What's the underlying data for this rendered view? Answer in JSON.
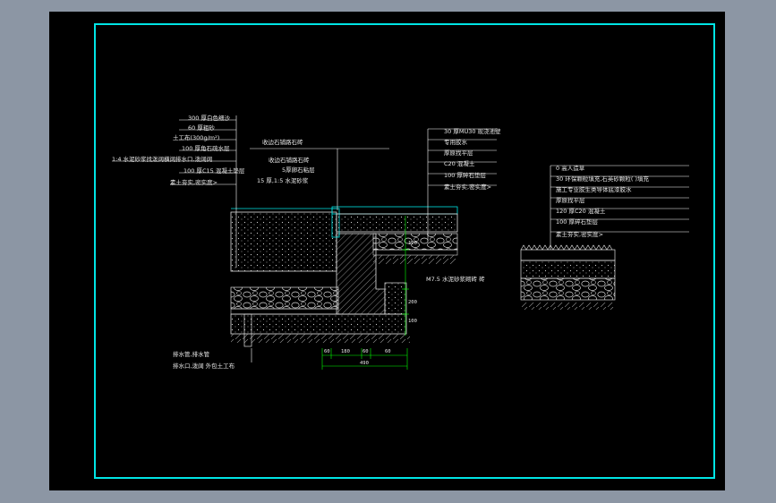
{
  "colors": {
    "background": "#8c96a4",
    "paper": "#000000",
    "border": "#00e5e5",
    "leader": "#ffffff",
    "dimension": "#00ff00",
    "water": "#00e5e5",
    "stone": "#e0e0e0",
    "hatch": "#b0b0b0"
  },
  "left_labels": [
    "300 厚白色细沙",
    "60 厚粗砂",
    "土工布(300g/m²)",
    "100 厚角石疏水层",
    "1:4 水泥砂浆找泼阔横阔排水口,泼阔阔",
    "100 厚C15 混凝土垫层",
    "素土夯实,密实度>"
  ],
  "middle_labels": [
    "收边石铺路石砖",
    "收边石铺路石砖",
    "5厚卵石粘层",
    "15 厚,1:5 水泥砂浆"
  ],
  "right_labels": [
    "30 厚MU30 现浇池壁",
    "专用胶水",
    "厚原找平层",
    "C20 混凝土",
    "100 厚碎石垫层",
    "素土夯实,密实度>"
  ],
  "far_right_labels": [
    "0 高人造草",
    "30 环保颗粒填充,石英砂颗粒( )填充",
    "施工专业胶生类导体底漆胶水",
    "厚原找平层",
    "120 厚C20 混凝土",
    "100 厚碎石垫层",
    "素土夯实,密实度>"
  ],
  "bottom_labels": [
    "排水管,排水管",
    "排水口,泼阔 外包土工布"
  ],
  "annotation": "M7.5 水泥砂浆砌砖 砖",
  "dimensions": {
    "segments": [
      "60",
      "180",
      "60",
      "60"
    ],
    "total": "490",
    "vertical": [
      "120",
      "200",
      "100"
    ]
  }
}
